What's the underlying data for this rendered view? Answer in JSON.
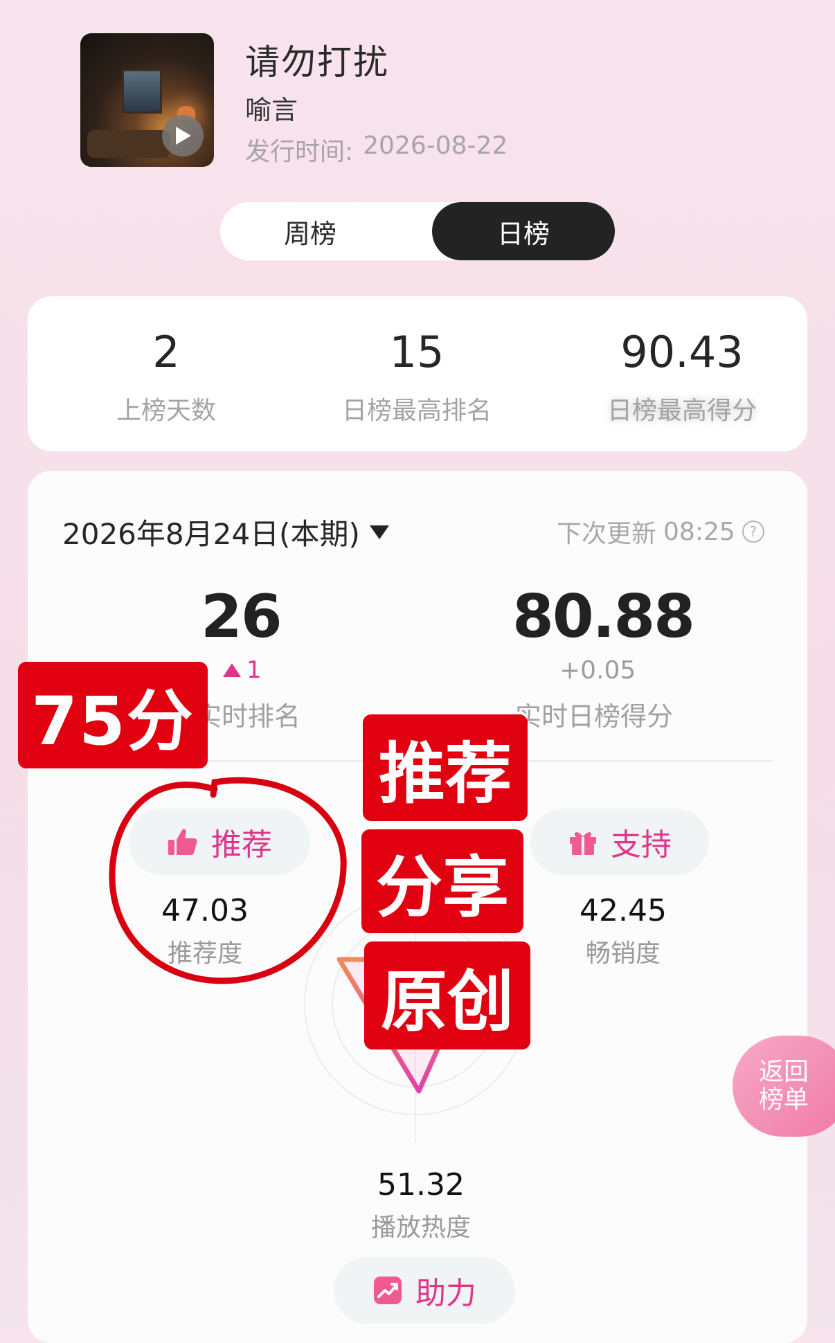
{
  "song": {
    "title": "请勿打扰",
    "artist": "喻言",
    "release_label": "发行时间:",
    "release_date": "2026-08-22"
  },
  "tabs": {
    "week": "周榜",
    "day": "日榜",
    "active": "日榜"
  },
  "stats": {
    "days_on_chart": {
      "value": "2",
      "label": "上榜天数"
    },
    "best_daily_rank": {
      "value": "15",
      "label": "日榜最高排名"
    },
    "score": {
      "value": "90.43",
      "label": "日榜最高得分"
    }
  },
  "period": {
    "label": "2026年8月24日(本期)",
    "next_update_label": "下次更新",
    "next_update_time": "08:25"
  },
  "realtime": {
    "rank": "26",
    "rank_change": "1",
    "rank_label": "实时排名",
    "score": "80.88",
    "score_change": "+0.05",
    "score_label": "实时日榜得分"
  },
  "actions": {
    "recommend": "推荐",
    "support": "支持",
    "boost": "助力"
  },
  "metrics": {
    "recommend": {
      "value": "47.03",
      "label": "推荐度"
    },
    "sales": {
      "value": "42.45",
      "label": "畅销度"
    },
    "play": {
      "value": "51.32",
      "label": "播放热度"
    }
  },
  "back_button": {
    "line1": "返回",
    "line2": "榜单"
  },
  "overlays": {
    "score_stamp": "75分",
    "tag1": "推荐",
    "tag2": "分享",
    "tag3": "原创"
  },
  "colors": {
    "accent_pink": "#e0348b",
    "overlay_red": "#e0000f",
    "tab_active_bg": "#232323"
  },
  "icons": [
    "play-icon",
    "thumbs-up-icon",
    "gift-icon",
    "trend-up-icon",
    "help-circle-icon",
    "dropdown-triangle-icon"
  ]
}
